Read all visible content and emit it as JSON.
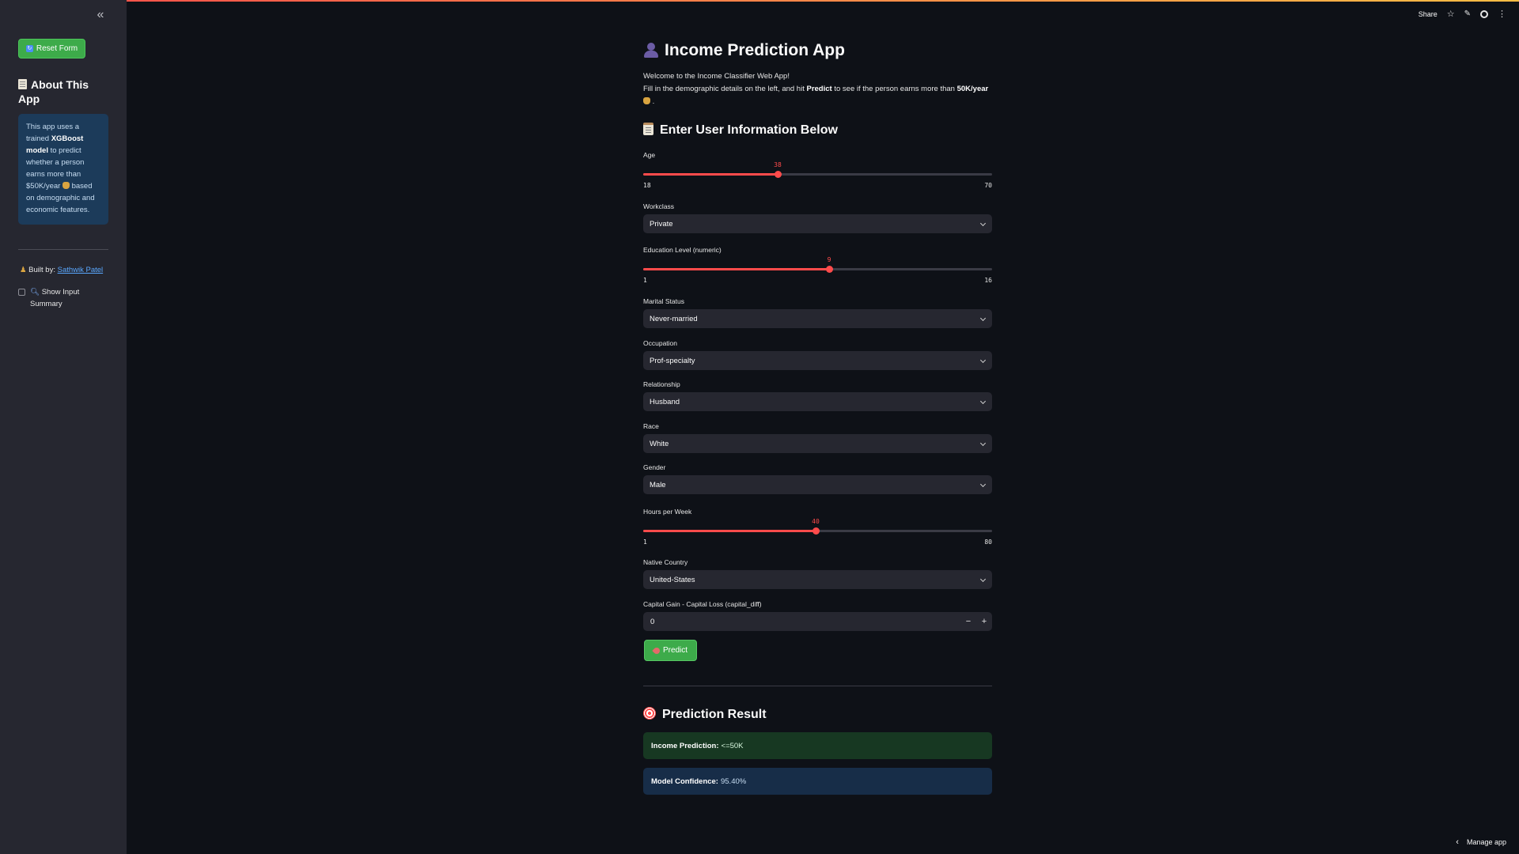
{
  "sidebar": {
    "reset_button": "Reset Form",
    "about_title": "About This App",
    "info": {
      "pre": "This app uses a trained ",
      "model": "XGBoost model",
      "mid": " to predict whether a person earns more than $50K/year ",
      "post": " based on demographic and economic features."
    },
    "built_by_label": "Built by:",
    "built_by_name": "Sathwik Patel",
    "show_summary_label": "Show Input Summary",
    "show_summary_checked": false
  },
  "header": {
    "share": "Share"
  },
  "main": {
    "title": "Income Prediction App",
    "intro_line1": "Welcome to the Income Classifier Web App!",
    "intro_line2_pre": "Fill in the demographic details on the left, and hit ",
    "intro_line2_bold": "Predict",
    "intro_line2_mid": " to see if the person earns more than ",
    "intro_line2_bold2": "50K/year",
    "section_title": "Enter User Information Below",
    "age": {
      "label": "Age",
      "value": "38",
      "min": "18",
      "max": "70",
      "fraction": 0.385
    },
    "workclass": {
      "label": "Workclass",
      "value": "Private"
    },
    "education": {
      "label": "Education Level (numeric)",
      "value": "9",
      "min": "1",
      "max": "16",
      "fraction": 0.533
    },
    "marital": {
      "label": "Marital Status",
      "value": "Never-married"
    },
    "occupation": {
      "label": "Occupation",
      "value": "Prof-specialty"
    },
    "relationship": {
      "label": "Relationship",
      "value": "Husband"
    },
    "race": {
      "label": "Race",
      "value": "White"
    },
    "gender": {
      "label": "Gender",
      "value": "Male"
    },
    "hours": {
      "label": "Hours per Week",
      "value": "40",
      "min": "1",
      "max": "80",
      "fraction": 0.494
    },
    "country": {
      "label": "Native Country",
      "value": "United-States"
    },
    "capital": {
      "label": "Capital Gain - Capital Loss (capital_diff)",
      "value": "0"
    },
    "predict_button": "Predict",
    "result_title": "Prediction Result",
    "prediction_label": "Income Prediction:",
    "prediction_value": "<=50K",
    "confidence_label": "Model Confidence:",
    "confidence_value": "95.40%"
  },
  "footer": {
    "manage_app": "Manage app"
  },
  "colors": {
    "accent": "#ff4b4b",
    "success_btn": "#3dab4a",
    "background": "#0e1117",
    "sidebar": "#262730"
  }
}
